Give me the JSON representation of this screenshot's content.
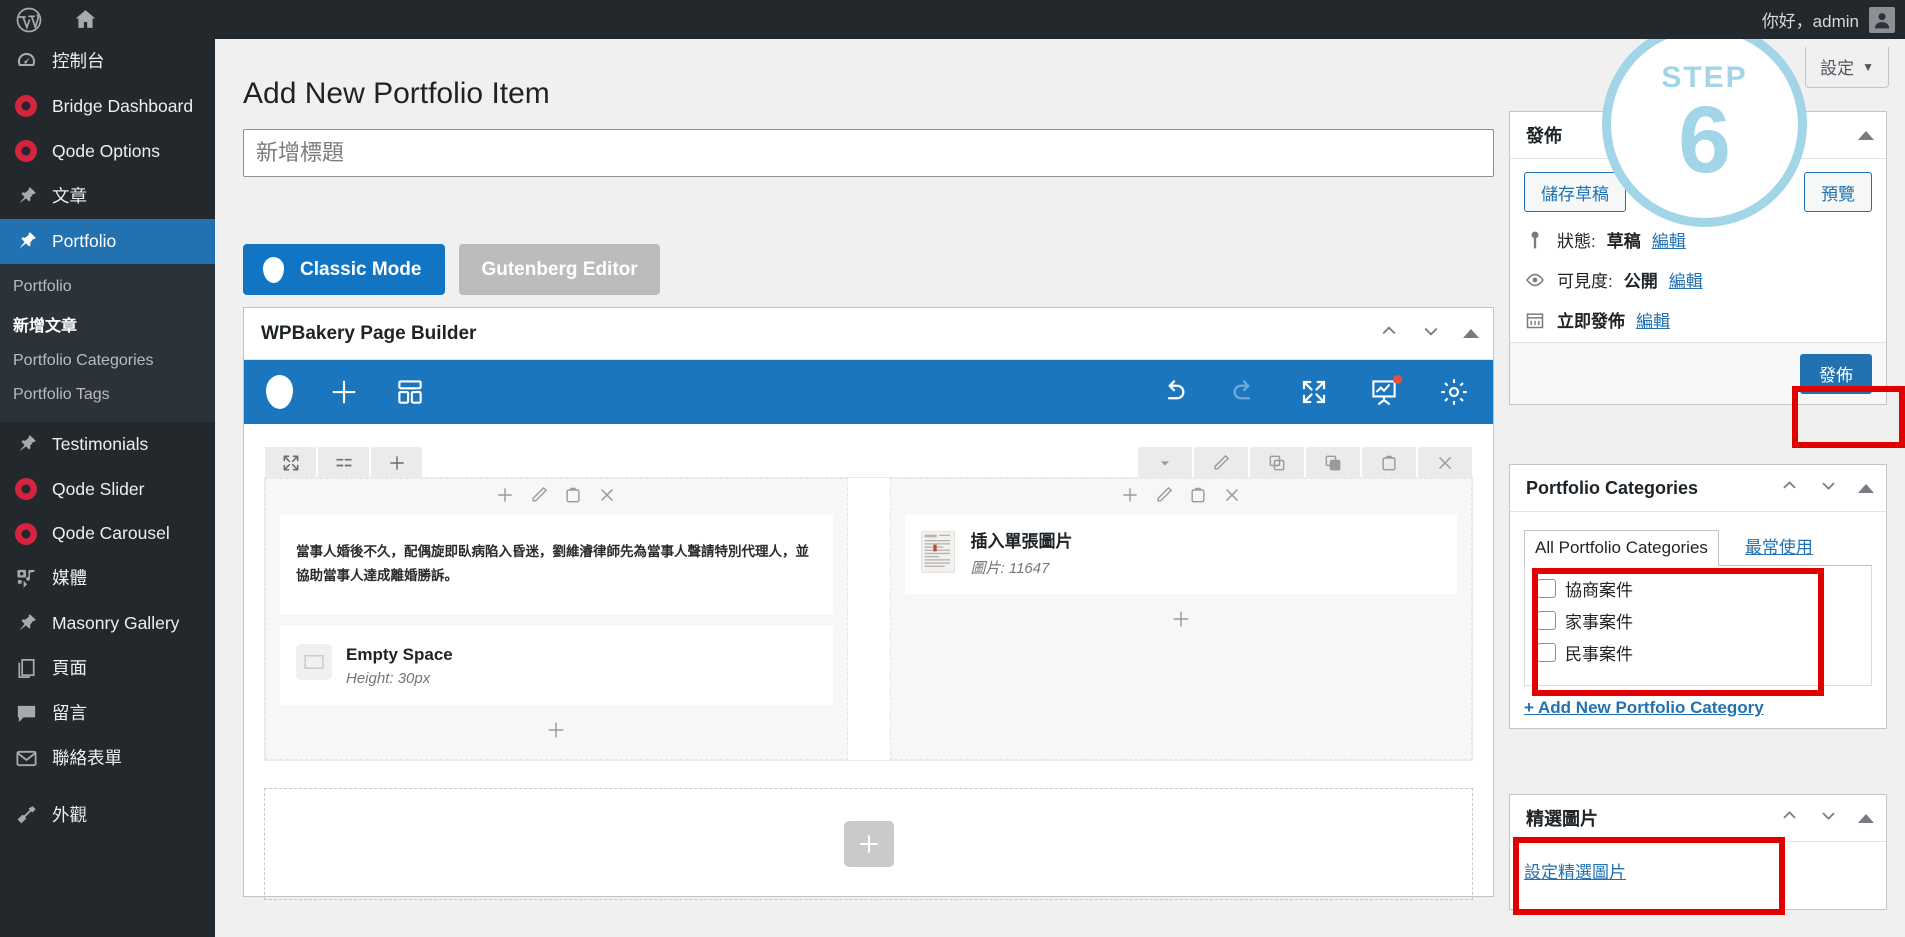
{
  "adminbar": {
    "wp_logo_icon": "wordpress-icon",
    "home_icon": "home-icon",
    "greeting": "你好，admin",
    "avatar_icon": "avatar-icon"
  },
  "sidebar": {
    "items": [
      {
        "label": "控制台",
        "icon": "dashboard-icon",
        "type": "dashicon"
      },
      {
        "label": "Bridge Dashboard",
        "icon": "qode-dot-icon",
        "type": "qode"
      },
      {
        "label": "Qode Options",
        "icon": "qode-dot-icon",
        "type": "qode"
      },
      {
        "label": "文章",
        "icon": "pin-icon",
        "type": "dashicon"
      },
      {
        "label": "Portfolio",
        "icon": "pin-icon",
        "type": "dashicon",
        "current": true
      },
      {
        "label": "Testimonials",
        "icon": "pin-icon",
        "type": "dashicon"
      },
      {
        "label": "Qode Slider",
        "icon": "qode-dot-icon",
        "type": "qode"
      },
      {
        "label": "Qode Carousel",
        "icon": "qode-dot-icon",
        "type": "qode"
      },
      {
        "label": "媒體",
        "icon": "media-icon",
        "type": "dashicon"
      },
      {
        "label": "Masonry Gallery",
        "icon": "pin-icon",
        "type": "dashicon"
      },
      {
        "label": "頁面",
        "icon": "pages-icon",
        "type": "dashicon"
      },
      {
        "label": "留言",
        "icon": "comment-icon",
        "type": "dashicon"
      },
      {
        "label": "聯絡表單",
        "icon": "envelope-icon",
        "type": "dashicon"
      },
      {
        "label": "外觀",
        "icon": "appearance-icon",
        "type": "dashicon"
      }
    ],
    "submenu": [
      {
        "label": "Portfolio"
      },
      {
        "label": "新增文章",
        "current": true
      },
      {
        "label": "Portfolio Categories"
      },
      {
        "label": "Portfolio Tags"
      }
    ]
  },
  "screen_meta": {
    "label": "設定",
    "caret": "▼"
  },
  "main": {
    "page_title": "Add New Portfolio Item",
    "title_placeholder": "新增標題",
    "title_value": "",
    "mode_classic": "Classic Mode",
    "mode_gutenberg": "Gutenberg Editor"
  },
  "wpbakery": {
    "panel_title": "WPBakery Page Builder",
    "header_controls": [
      "chevron-up-icon",
      "chevron-down-icon",
      "triangle-up-icon"
    ],
    "toolbar_left_icons": [
      "wpb-logo-icon",
      "add-element-icon",
      "templates-icon"
    ],
    "toolbar_right_icons": [
      "undo-icon",
      "redo-icon",
      "fullscreen-icon",
      "presentation-icon",
      "settings-gear-icon"
    ],
    "row_controls_left": [
      "resize-columns-icon",
      "row-layout-icon",
      "add-icon"
    ],
    "row_controls_right": [
      "chevron-down-icon",
      "edit-pencil-icon",
      "copy-icon",
      "clone-icon",
      "clipboard-icon",
      "close-x-icon"
    ],
    "column_controls": [
      "add-icon",
      "edit-pencil-icon",
      "clipboard-icon",
      "close-x-icon"
    ],
    "left_column": {
      "text_block": "當事人婚後不久，配偶旋即臥病陷入昏迷，劉維濬律師先為當事人聲請特別代理人，並協助當事人達成離婚勝訴。",
      "empty_space_title": "Empty Space",
      "empty_space_sub": "Height: 30px"
    },
    "right_column": {
      "image_title": "插入單張圖片",
      "image_sub": "圖片: 11647"
    }
  },
  "publish_box": {
    "title": "發佈",
    "save_draft": "儲存草稿",
    "preview": "預覽",
    "status_label": "狀態:",
    "status_value": "草稿",
    "status_edit": "編輯",
    "visibility_label": "可見度:",
    "visibility_value": "公開",
    "visibility_edit": "編輯",
    "schedule_label": "立即發佈",
    "schedule_edit": "編輯",
    "publish_button": "發佈",
    "icons": {
      "status": "pin-marker-icon",
      "visibility": "eye-icon",
      "schedule": "calendar-icon"
    }
  },
  "categories_box": {
    "title": "Portfolio Categories",
    "tab_all": "All Portfolio Categories",
    "tab_most_used": "最常使用",
    "items": [
      {
        "label": "協商案件",
        "checked": false
      },
      {
        "label": "家事案件",
        "checked": false
      },
      {
        "label": "民事案件",
        "checked": false
      }
    ],
    "add_new": "+ Add New Portfolio Category"
  },
  "featured_image_box": {
    "title": "精選圖片",
    "set_link": "設定精選圖片"
  },
  "step_badge": {
    "label": "STEP",
    "number": "6",
    "color": "#a3d5e8"
  },
  "highlights": {
    "color": "#e30000",
    "count": 4
  }
}
